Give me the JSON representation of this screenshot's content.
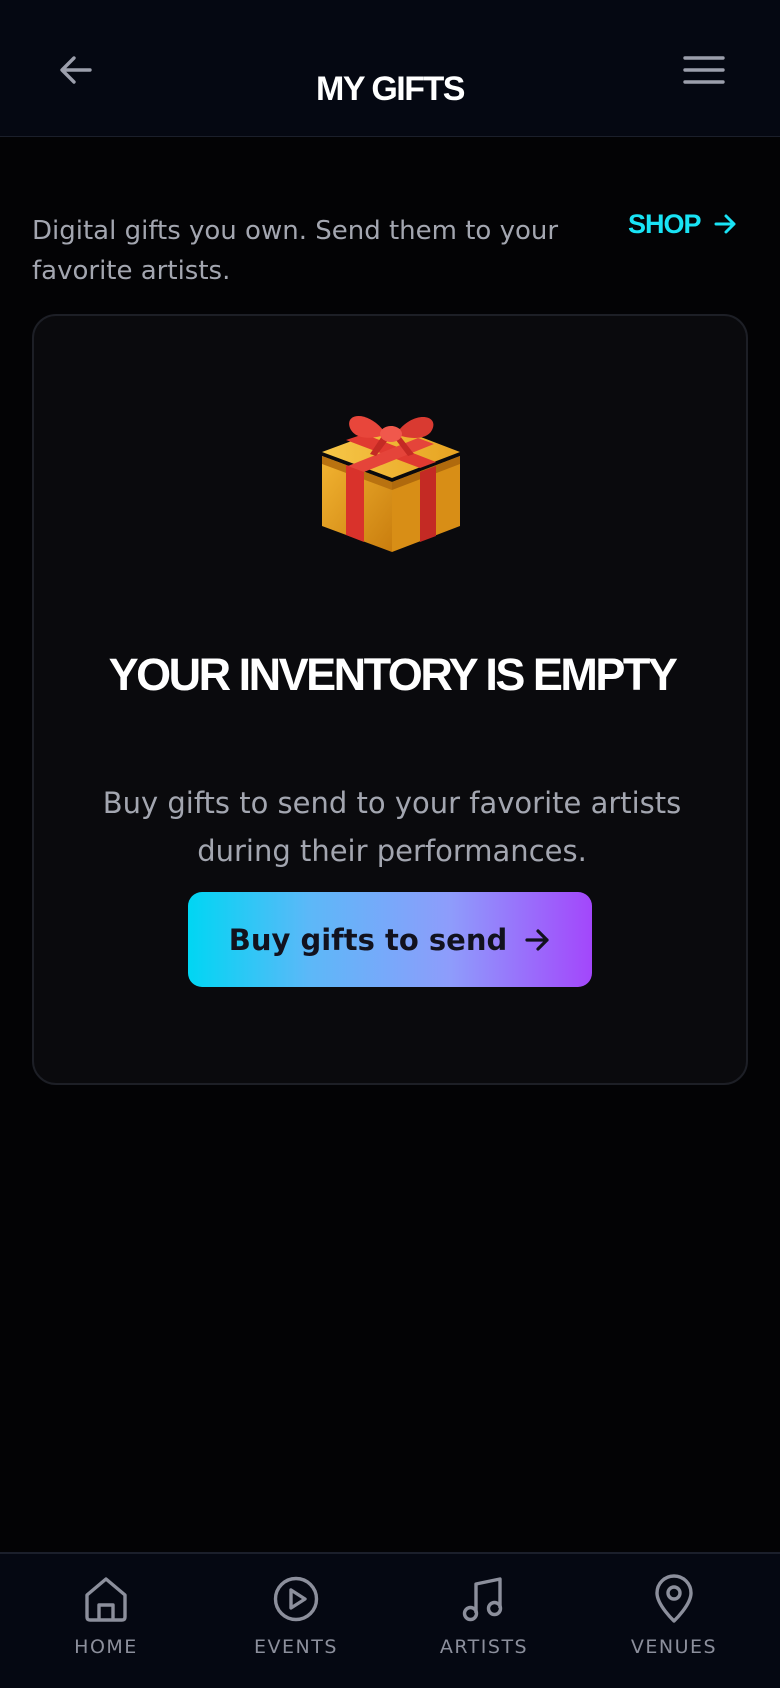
{
  "header": {
    "title": "MY GIFTS",
    "back_icon": "arrow-left-icon",
    "menu_icon": "hamburger-menu-icon"
  },
  "intro": {
    "text": "Digital gifts you own. Send them to your favorite artists.",
    "shop_label": "SHOP",
    "shop_icon": "arrow-right-icon"
  },
  "empty_state": {
    "icon": "gift-icon",
    "title": "YOUR INVENTORY IS EMPTY",
    "description": "Buy gifts to send to your favorite artists during their performances.",
    "button_label": "Buy gifts to send",
    "button_icon": "arrow-right-icon"
  },
  "bottom_nav": {
    "items": [
      {
        "label": "HOME",
        "icon": "home-icon"
      },
      {
        "label": "EVENTS",
        "icon": "play-circle-icon"
      },
      {
        "label": "ARTISTS",
        "icon": "music-note-icon"
      },
      {
        "label": "VENUES",
        "icon": "map-pin-icon"
      }
    ]
  },
  "colors": {
    "background": "#030305",
    "bar_background": "#050812",
    "accent_cyan": "#19e3f5",
    "accent_purple": "#a347fb",
    "muted_text": "#a3a6b0"
  }
}
